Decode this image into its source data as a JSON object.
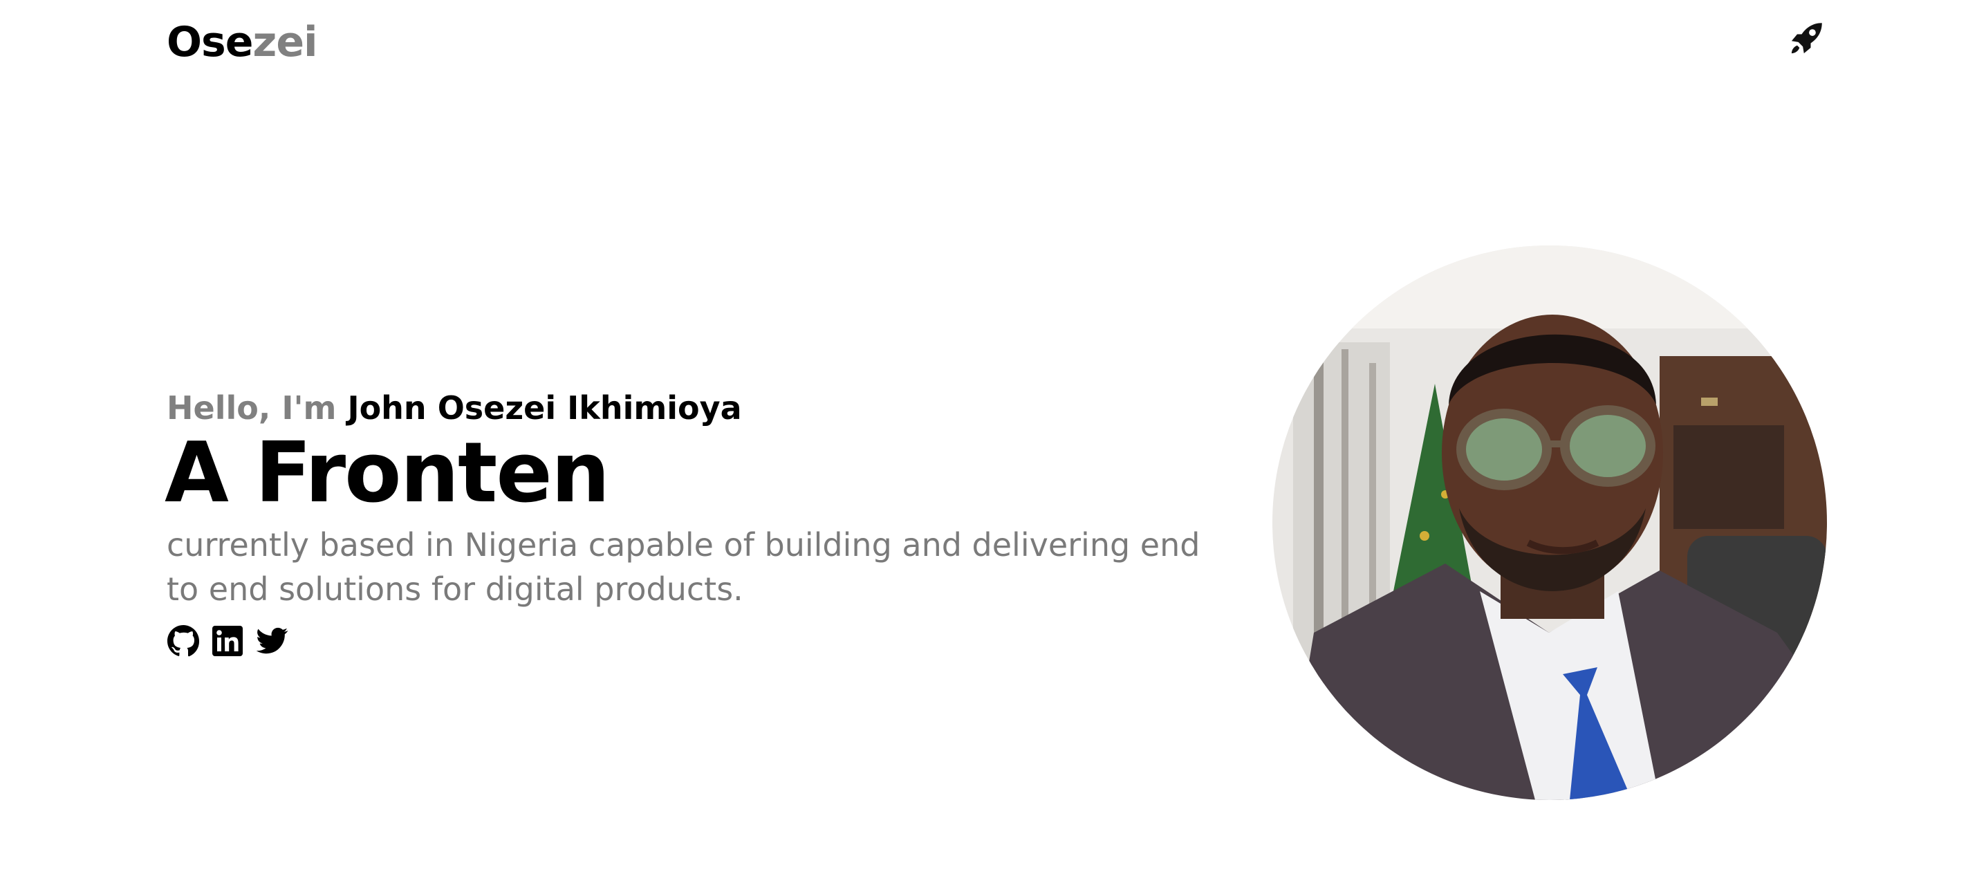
{
  "header": {
    "logo_part1": "Ose",
    "logo_part2": "zei",
    "theme_icon": "rocket-icon"
  },
  "hero": {
    "greeting": "Hello, I'm",
    "name": "John Osezei Ikhimioya",
    "headline": "A Fronten",
    "tagline": "currently based in Nigeria capable of building and delivering end to end solutions for digital products.",
    "socials": [
      {
        "name": "github-icon"
      },
      {
        "name": "linkedin-icon"
      },
      {
        "name": "twitter-icon"
      }
    ]
  },
  "portrait": {
    "description": "profile-photo"
  },
  "colors": {
    "primary": "#000000",
    "muted": "#808080",
    "background": "#ffffff"
  }
}
